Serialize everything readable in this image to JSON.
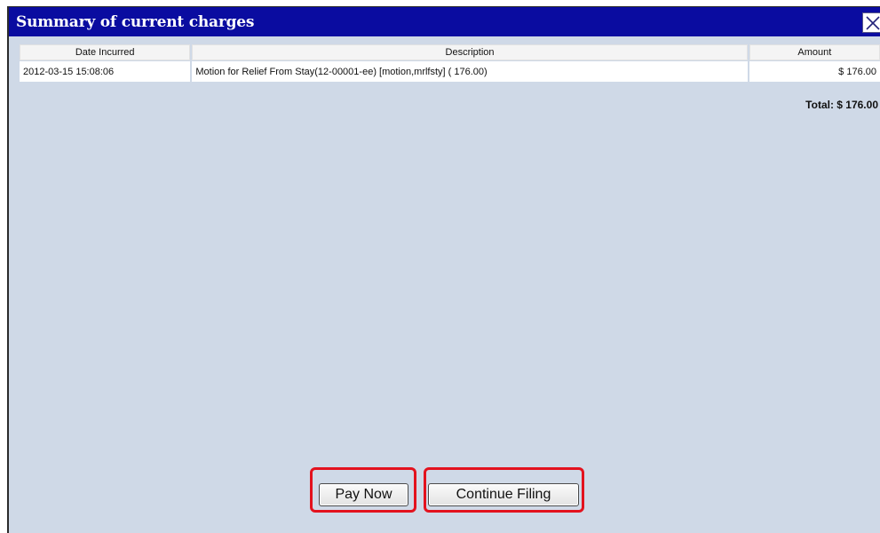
{
  "dialog": {
    "title": "Summary of current charges",
    "close_icon": "close-icon"
  },
  "table": {
    "headers": [
      "Date Incurred",
      "Description",
      "Amount"
    ],
    "rows": [
      {
        "date": "2012-03-15 15:08:06",
        "description": "Motion for Relief From Stay(12-00001-ee) [motion,mrlfsty] ( 176.00)",
        "amount": "$ 176.00"
      }
    ],
    "total": "Total: $ 176.00"
  },
  "buttons": {
    "pay_now": "Pay Now",
    "continue_filing": "Continue Filing"
  },
  "colors": {
    "titlebar": "#0a0ca0",
    "panel_background": "#cfd9e7",
    "highlight": "#e3121e"
  }
}
